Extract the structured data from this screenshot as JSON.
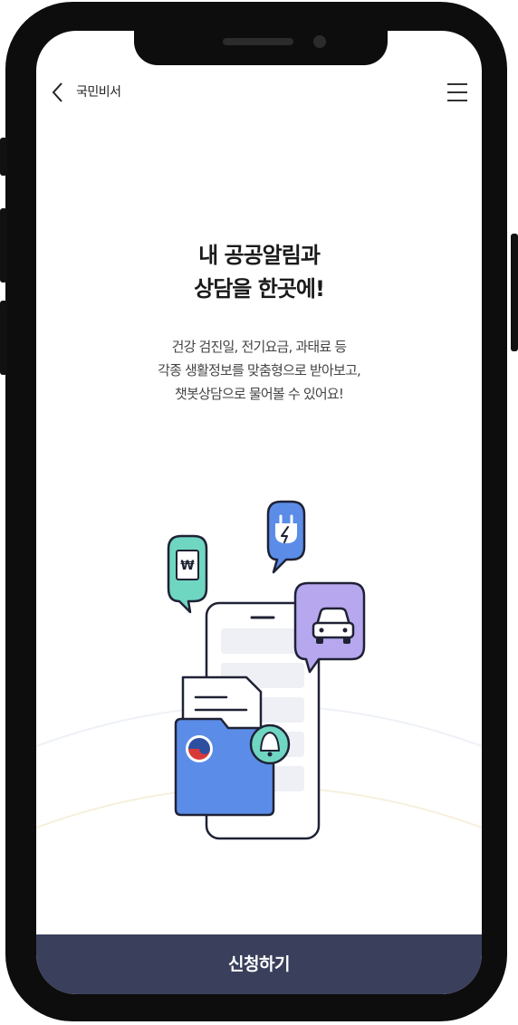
{
  "header": {
    "title": "국민비서",
    "back_icon": "chevron-left-icon",
    "menu_icon": "hamburger-menu-icon"
  },
  "main": {
    "headline_line1": "내 공공알림과",
    "headline_line2": "상담을 한곳에!",
    "description_line1": "건강 검진일, 전기요금, 과태료 등",
    "description_line2": "각종 생활정보를 맞춤형으로 받아보고,",
    "description_line3": "챗봇상담으로 물어볼 수 있어요!"
  },
  "illustration": {
    "bill_bubble_symbol": "₩",
    "icons": [
      "won-bill-icon",
      "electric-plug-icon",
      "car-icon",
      "government-emblem-icon",
      "bell-icon"
    ],
    "colors": {
      "mint": "#6fd6c2",
      "blue": "#5b8de8",
      "lavender": "#b6a7ee",
      "outline": "#1f2235"
    }
  },
  "footer": {
    "cta_label": "신청하기",
    "cta_color": "#3a3f5c"
  }
}
